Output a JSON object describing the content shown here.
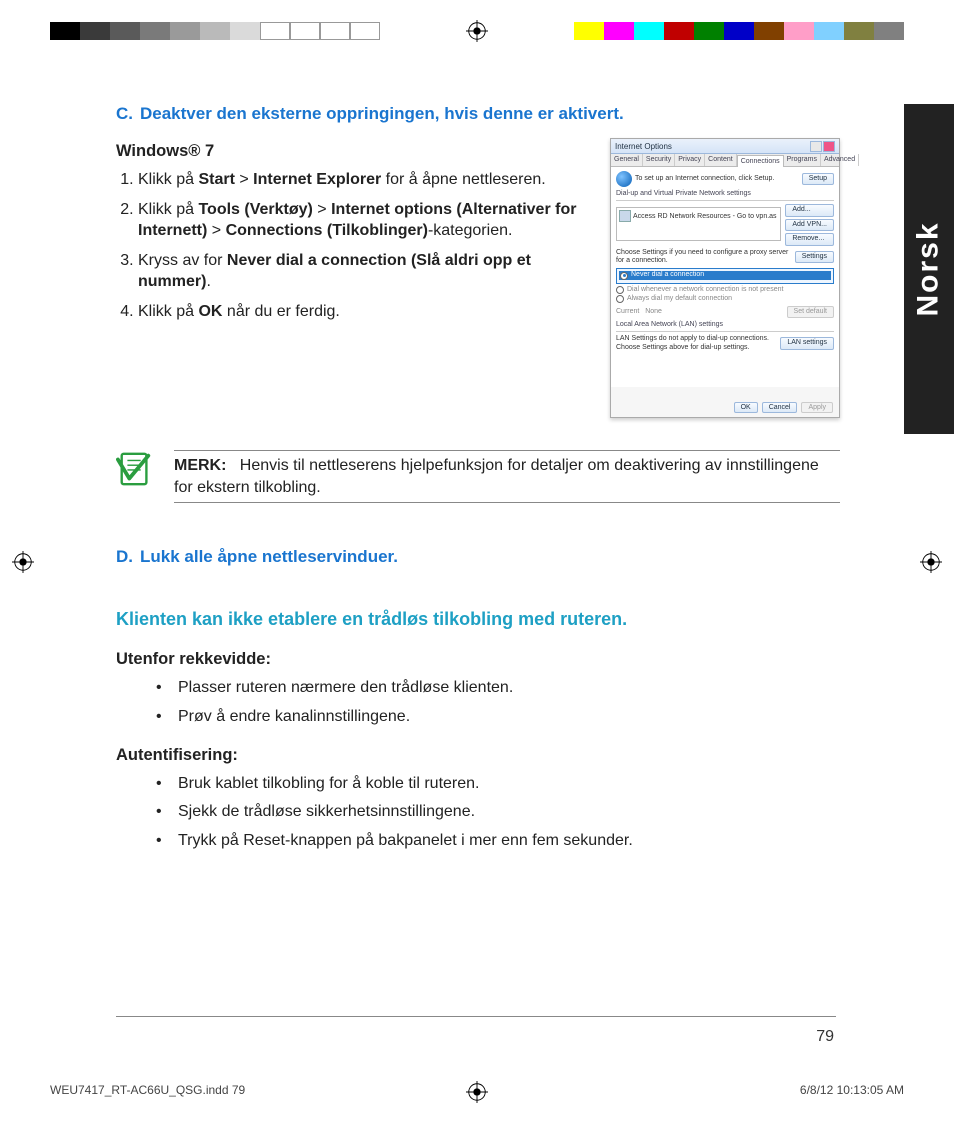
{
  "section_c": {
    "letter": "C.",
    "title": "Deaktver den eksterne oppringingen, hvis denne er aktivert.",
    "os_label": "Windows® 7",
    "steps": [
      {
        "pre": "Klikk på ",
        "b1": "Start",
        "mid": " > ",
        "b2": "Internet Explorer",
        "post": " for å åpne nett­leseren."
      },
      {
        "pre": "Klikk på ",
        "b1": "Tools (Verktøy)",
        "mid": " > ",
        "b2": "Internet options (Al­ternativer for Internett)",
        "mid2": " > ",
        "b3": "Connections (Tilkob­linger)",
        "post": "-kategorien."
      },
      {
        "pre": "Kryss av for ",
        "b1": "Never dial a connection (Slå aldri opp et nummer)",
        "post": "."
      },
      {
        "pre": "Klikk på ",
        "b1": "OK",
        "post": " når du er ferdig."
      }
    ]
  },
  "dialog": {
    "title": "Internet Options",
    "tabs": [
      "General",
      "Security",
      "Privacy",
      "Content",
      "Connections",
      "Programs",
      "Advanced"
    ],
    "setup_text": "To set up an Internet connection, click Setup.",
    "setup_btn": "Setup",
    "dialup_label": "Dial-up and Virtual Private Network settings",
    "list_item": "Access RD Network Resources - Go to vpn.as",
    "add_btn": "Add...",
    "addvpn_btn": "Add VPN...",
    "remove_btn": "Remove...",
    "settings_text": "Choose Settings if you need to configure a proxy server for a connection.",
    "settings_btn": "Settings",
    "radio1": "Never dial a connection",
    "radio2": "Dial whenever a network connection is not present",
    "radio3": "Always dial my default connection",
    "current_lbl": "Current",
    "current_val": "None",
    "setdefault_btn": "Set default",
    "lan_label": "Local Area Network (LAN) settings",
    "lan_text": "LAN Settings do not apply to dial-up connections. Choose Settings above for dial-up settings.",
    "lan_btn": "LAN settings",
    "ok_btn": "OK",
    "cancel_btn": "Cancel",
    "apply_btn": "Apply"
  },
  "note": {
    "label": "MERK:",
    "text": "Henvis til nettleserens hjelpefunksjon for detaljer om deakti­vering av innstillingene for ekstern tilkobling."
  },
  "section_d": {
    "letter": "D.",
    "title": "Lukk alle åpne nettleservinduer."
  },
  "cyan_heading": "Klienten kan ikke etablere en trådløs tilkobling med ruteren.",
  "group1": {
    "heading": "Utenfor rekkevidde:",
    "bullets": [
      "Plasser ruteren nærmere den trådløse klienten.",
      "Prøv å endre kanalinnstillingene."
    ]
  },
  "group2": {
    "heading": "Autentifisering:",
    "bullets": [
      "Bruk kablet tilkobling for å koble til ruteren.",
      "Sjekk de trådløse sikkerhetsinnstillingene.",
      "Trykk på Reset-knappen på bakpanelet i mer enn fem sekunder."
    ]
  },
  "side_tab": "Norsk",
  "page_number": "79",
  "slug_left": "WEU7417_RT-AC66U_QSG.indd   79",
  "slug_right": "6/8/12   10:13:05 AM",
  "colors": {
    "left_bar": [
      "#000000",
      "#3a3a3a",
      "#5a5a5a",
      "#7a7a7a",
      "#9a9a9a",
      "#bababa",
      "#dadada",
      "#ffffff",
      "#ffffff",
      "#ffffff",
      "#ffffff"
    ],
    "right_bar": [
      "#ffff00",
      "#ff00ff",
      "#00ffff",
      "#c00000",
      "#008000",
      "#0000c8",
      "#804000",
      "#ff9ec8",
      "#80d0ff",
      "#808040",
      "#808080"
    ]
  }
}
